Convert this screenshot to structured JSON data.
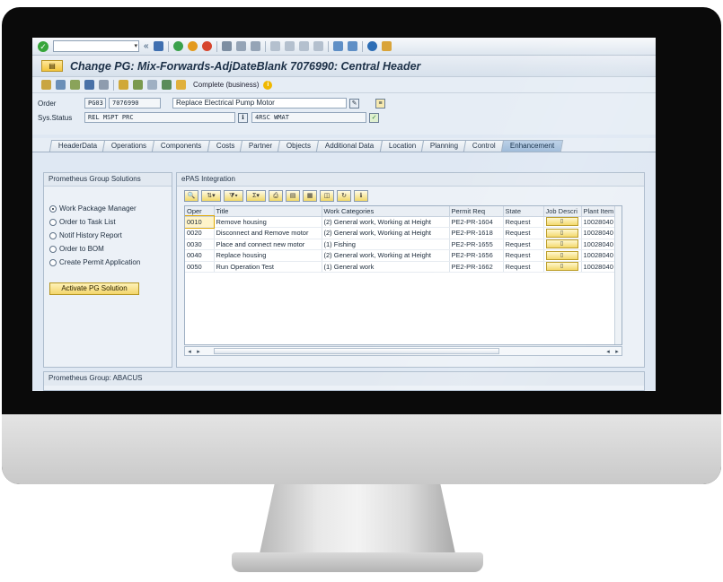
{
  "window": {
    "title": "Change PG: Mix-Forwards-AdjDateBlank 7076990: Central Header",
    "command_value": "",
    "complete_label": "Complete (business)"
  },
  "form": {
    "order_label": "Order",
    "order_type": "PG03",
    "order_number": "7076990",
    "order_description": "Replace Electrical Pump Motor",
    "status_label": "Sys.Status",
    "status_value": "REL  MSPT PRC",
    "user_status": "4RSC WMAT"
  },
  "tabs": [
    {
      "label": "HeaderData"
    },
    {
      "label": "Operations"
    },
    {
      "label": "Components"
    },
    {
      "label": "Costs"
    },
    {
      "label": "Partner"
    },
    {
      "label": "Objects"
    },
    {
      "label": "Additional Data"
    },
    {
      "label": "Location"
    },
    {
      "label": "Planning"
    },
    {
      "label": "Control"
    },
    {
      "label": "Enhancement"
    }
  ],
  "active_tab": "Enhancement",
  "left_panel": {
    "title": "Prometheus Group Solutions",
    "options": [
      {
        "label": "Work Package Manager",
        "selected": true
      },
      {
        "label": "Order to Task List",
        "selected": false
      },
      {
        "label": "Notif History Report",
        "selected": false
      },
      {
        "label": "Order to BOM",
        "selected": false
      },
      {
        "label": "Create Permit Application",
        "selected": false
      }
    ],
    "button_label": "Activate PG Solution"
  },
  "right_panel": {
    "title": "ePAS Integration",
    "columns": [
      "Oper",
      "Title",
      "Work Categories",
      "Permit Req",
      "State",
      "Job Descri",
      "Plant Item"
    ],
    "rows": [
      {
        "oper": "0010",
        "title": "Remove housing",
        "work": "(2) General work, Working at Height",
        "permit": "PE2-PR-1604",
        "state": "Request",
        "plant": "10028040"
      },
      {
        "oper": "0020",
        "title": "Disconnect and Remove motor",
        "work": "(2) General work, Working at Height",
        "permit": "PE2-PR-1618",
        "state": "Request",
        "plant": "10028040"
      },
      {
        "oper": "0030",
        "title": "Place and connect new motor",
        "work": "(1) Fishing",
        "permit": "PE2-PR-1655",
        "state": "Request",
        "plant": "10028040"
      },
      {
        "oper": "0040",
        "title": "Replace housing",
        "work": "(2) General work, Working at Height",
        "permit": "PE2-PR-1656",
        "state": "Request",
        "plant": "10028040"
      },
      {
        "oper": "0050",
        "title": "Run Operation Test",
        "work": "(1) General work",
        "permit": "PE2-PR-1662",
        "state": "Request",
        "plant": "10028040"
      }
    ]
  },
  "bottom_panel": {
    "title": "Prometheus Group: ABACUS"
  },
  "colors": {
    "accent": "#9cb9d8",
    "button_yellow": "#f3d56b",
    "screen_bg": "#dfe8f3"
  }
}
